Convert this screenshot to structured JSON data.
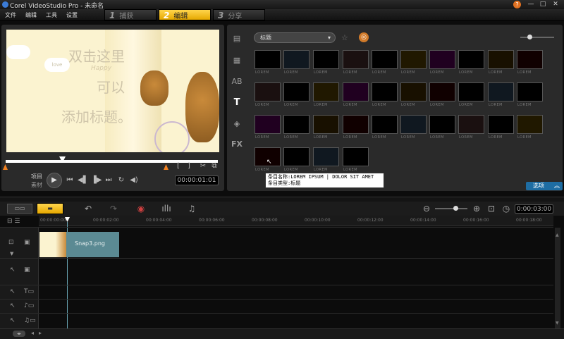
{
  "app": {
    "title": "Corel VideoStudio Pro - 未命名",
    "help": "?",
    "minimize": "—",
    "maximize": "□",
    "close": "✕"
  },
  "menu": [
    "文件",
    "编辑",
    "工具",
    "设置"
  ],
  "steps": [
    {
      "num": "1",
      "label": "捕获"
    },
    {
      "num": "2",
      "label": "编辑"
    },
    {
      "num": "3",
      "label": "分享"
    }
  ],
  "preview": {
    "line1": "双击这里",
    "line2": "可以",
    "line3": "添加标题。",
    "overlay": "Happy",
    "cloud": "love",
    "mode_project": "项目",
    "mode_clip": "素材",
    "timecode": "00:00:01:01"
  },
  "library": {
    "category": "标题",
    "thumb_label": "LOREM",
    "options_label": "选项"
  },
  "tooltip": {
    "name_line": "条目名称:LOREM IPSUM | DOLOR SIT AMET",
    "type_line": "条目类型:标题"
  },
  "timeline": {
    "duration": "0:00:03:00",
    "ticks": [
      "00:00:00:00",
      "00:00:02:00",
      "00:00:04:00",
      "00:00:06:00",
      "00:00:08:00",
      "00:00:10:00",
      "00:00:12:00",
      "00:00:14:00",
      "00:00:16:00",
      "00:00:18:00"
    ],
    "clip_label": "Snap3.png"
  },
  "colors": {
    "accent": "#f0b400",
    "selection": "#5b8a93"
  }
}
